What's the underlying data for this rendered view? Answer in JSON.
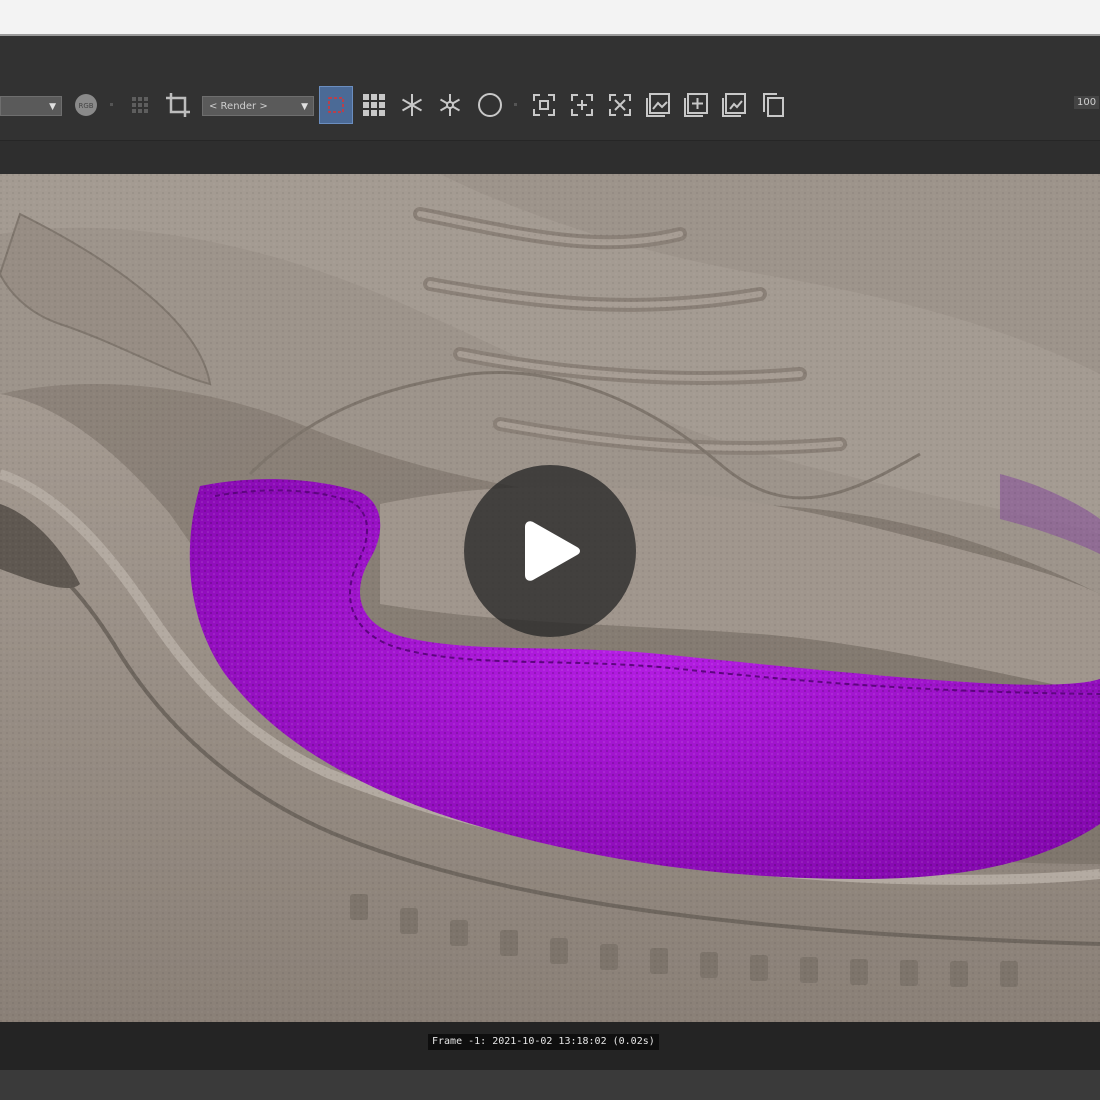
{
  "toolbar": {
    "left_dropdown_value": "",
    "render_dropdown_value": "< Render >",
    "zoom_value": "100",
    "icons": [
      "channel-icon",
      "grid-dots-icon",
      "crop-icon",
      "region-render-icon",
      "grid-icon",
      "snowflake-icon",
      "snowflake-outline-icon",
      "circle-icon",
      "fit-frame-icon",
      "frame-expand-icon",
      "frame-cross-icon",
      "save-image-icon",
      "add-image-icon",
      "compare-image-icon",
      "copy-image-icon"
    ]
  },
  "viewport": {
    "content": "sneaker render with purple leather panel",
    "accent_color": "#9a10c8",
    "play_icon": "play-icon"
  },
  "status": {
    "frame_info": "Frame -1: 2021-10-02 13:18:02 (0.02s)"
  }
}
